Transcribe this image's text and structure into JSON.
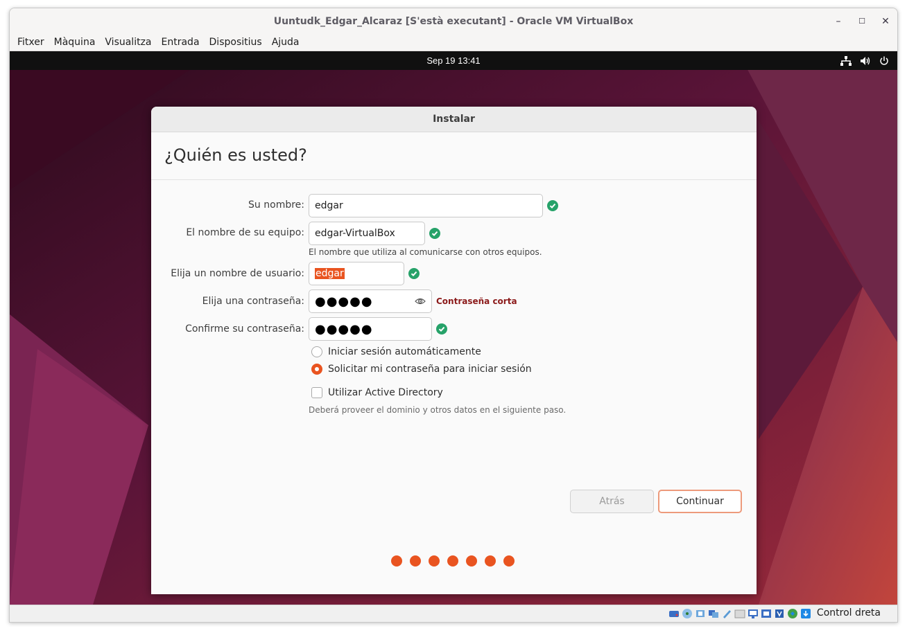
{
  "window": {
    "title": "Uuntudk_Edgar_Alcaraz [S'està executant] - Oracle VM VirtualBox",
    "controls": {
      "minimize": "–",
      "maximize": "☐",
      "close": "✕"
    }
  },
  "menubar": [
    "Fitxer",
    "Màquina",
    "Visualitza",
    "Entrada",
    "Dispositius",
    "Ajuda"
  ],
  "guest_topbar": {
    "clock": "Sep 19  13:41"
  },
  "installer": {
    "header": "Instalar",
    "page_title": "¿Quién es usted?",
    "fields": {
      "name": {
        "label": "Su nombre:",
        "value": "edgar"
      },
      "computer": {
        "label": "El nombre de su equipo:",
        "value": "edgar-VirtualBox",
        "hint": "El nombre que utiliza al comunicarse con otros equipos."
      },
      "username": {
        "label": "Elija un nombre de usuario:",
        "value": "edgar"
      },
      "password": {
        "label": "Elija una contraseña:",
        "value": "●●●●●",
        "error": "Contraseña corta"
      },
      "confirm": {
        "label": "Confirme su contraseña:",
        "value": "●●●●●"
      }
    },
    "login_options": {
      "auto": "Iniciar sesión automáticamente",
      "require": "Solicitar mi contraseña para iniciar sesión",
      "selected": "require"
    },
    "active_directory": {
      "label": "Utilizar Active Directory",
      "checked": false,
      "note": "Deberá proveer el dominio y otros datos en el siguiente paso."
    },
    "buttons": {
      "back": "Atrás",
      "next": "Continuar"
    },
    "progress_steps": 7
  },
  "statusbar": {
    "host_key": "Control dreta"
  },
  "colors": {
    "accent": "#e95420",
    "ok": "#26a269",
    "error": "#8b1a1a"
  }
}
